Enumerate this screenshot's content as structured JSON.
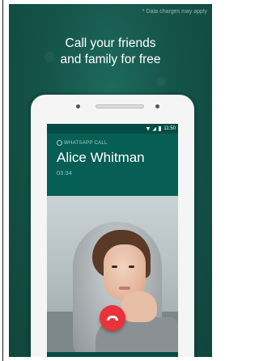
{
  "banner": {
    "disclaimer": "* Data charges may apply",
    "headline_line1": "Call your friends",
    "headline_line2": "and family for free"
  },
  "status_bar": {
    "time": "11:50"
  },
  "call": {
    "label": "WHATSAPP CALL",
    "caller_name": "Alice Whitman",
    "duration": "03:34"
  },
  "colors": {
    "brand_dark": "#075e54",
    "end_call": "#e8333a"
  },
  "icons": {
    "end_call": "phone-hangup-icon",
    "speaker": "speaker-icon",
    "video": "video-camera-icon",
    "mute": "mic-off-icon",
    "whatsapp": "whatsapp-icon"
  }
}
